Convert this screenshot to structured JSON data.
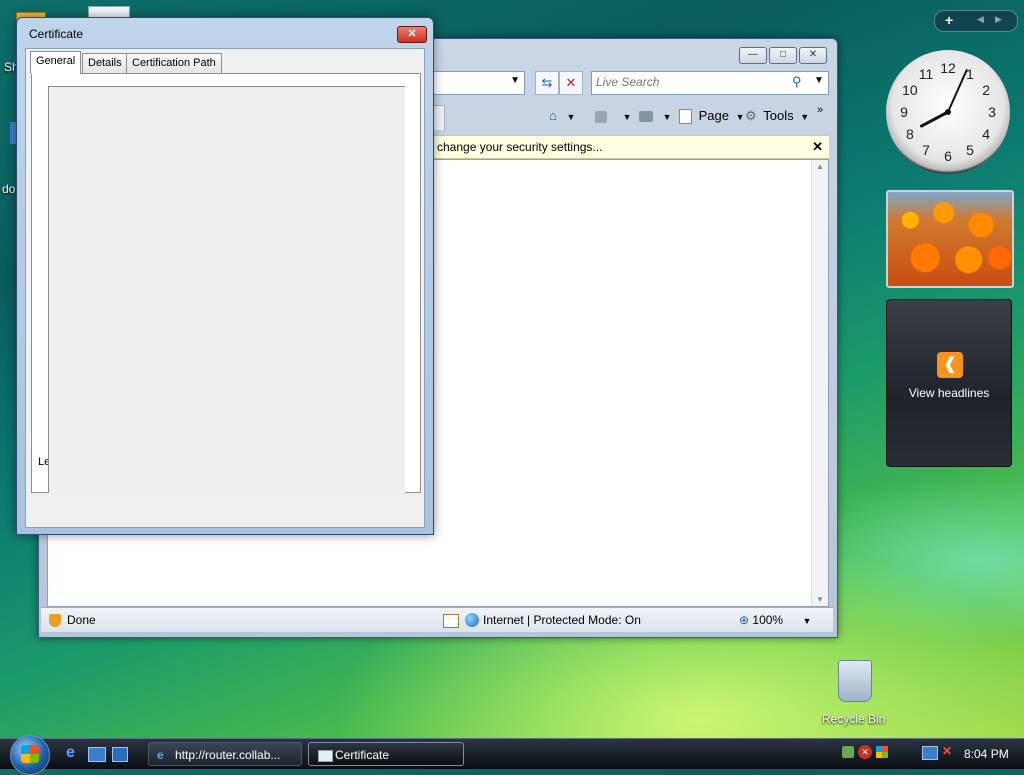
{
  "desktop": {
    "icons": {
      "left_top_label": "Sh",
      "left_mid_label": "do",
      "recycle_bin": "Recycle Bin"
    }
  },
  "ie": {
    "search_placeholder": "Live Search",
    "commands": {
      "page": "Page",
      "tools": "Tools"
    },
    "infobar_text": "change your security settings...",
    "status": {
      "left": "Done",
      "zone": "Internet | Protected Mode: On",
      "zoom": "100%"
    }
  },
  "certificate": {
    "title": "Certificate",
    "tabs": [
      "General",
      "Details",
      "Certification Path"
    ],
    "fragment_label": "Le"
  },
  "gadgets": {
    "feed_label": "View headlines",
    "clock": {
      "hour": 8,
      "minute": 4
    }
  },
  "taskbar": {
    "items": [
      {
        "label": "http://router.collab..."
      },
      {
        "label": "Certificate"
      }
    ],
    "time": "8:04 PM"
  },
  "colors": {
    "infobar": "#ffffe1",
    "feed_orange": "#f7931e",
    "close_red": "#c8321f"
  }
}
